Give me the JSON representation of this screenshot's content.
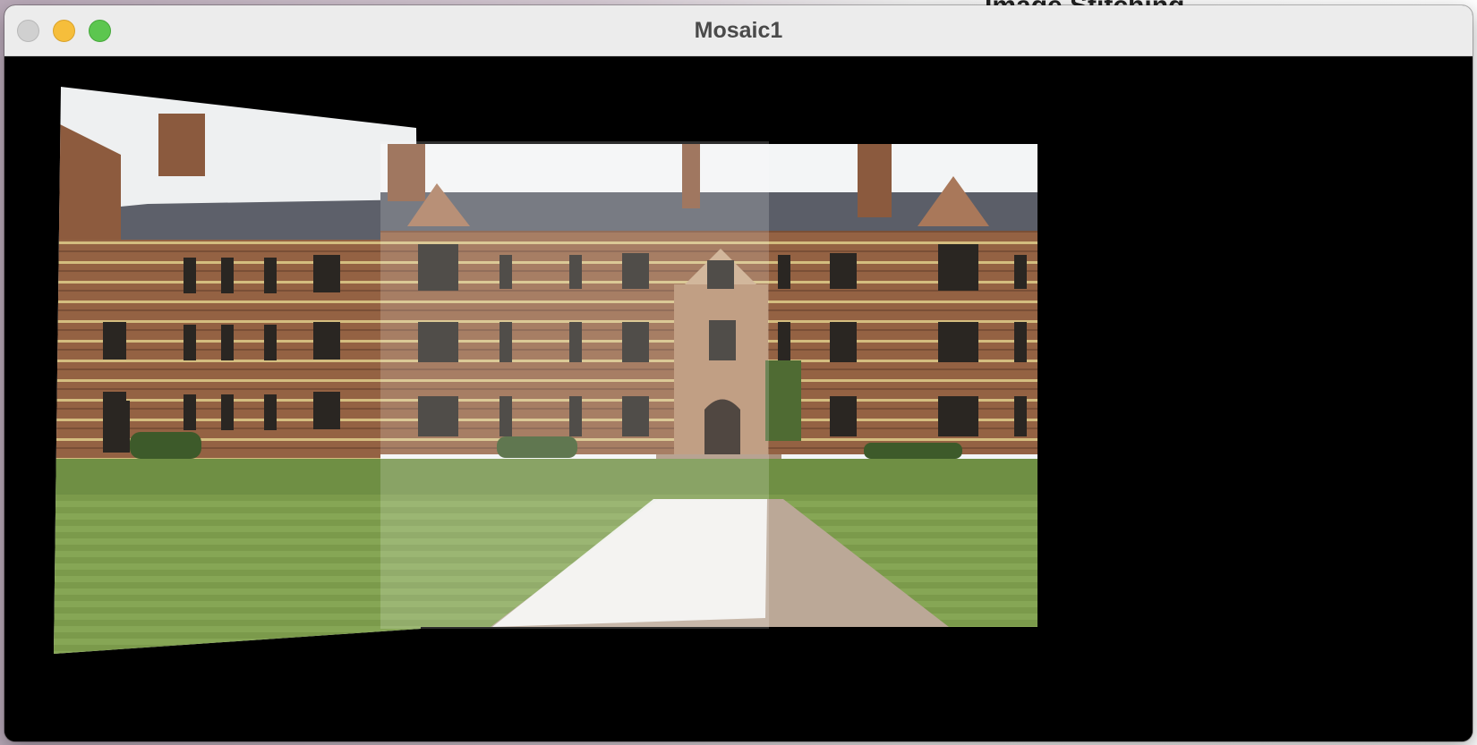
{
  "window": {
    "title": "Mosaic1"
  },
  "background_app": {
    "partial_title": "Image Stitching"
  },
  "image": {
    "description_icon": "mosaic-image",
    "colors": {
      "sky": "#f2f4f5",
      "roof": "#5c5f69",
      "brick": "#9a6a45",
      "stripe": "#d8c58a",
      "lawn": "#7e9b4c",
      "path": "#b9a99b",
      "background": "#000000"
    }
  }
}
